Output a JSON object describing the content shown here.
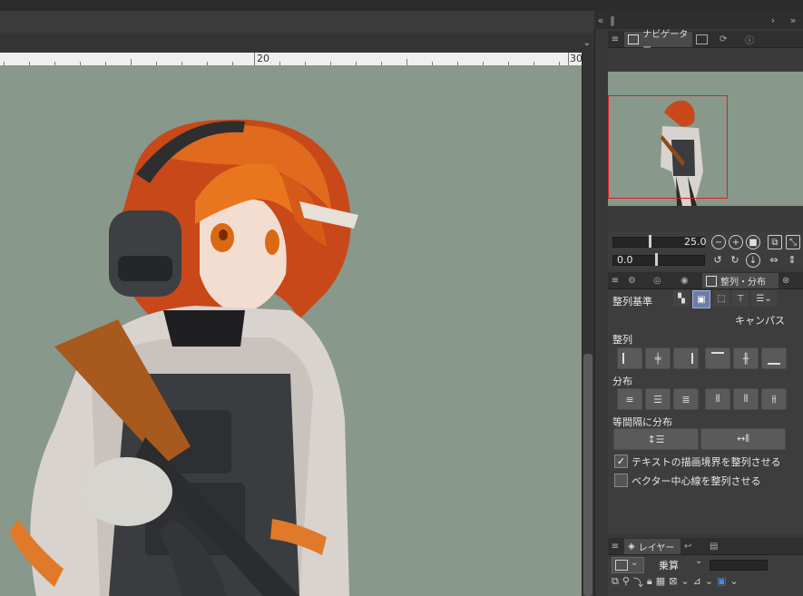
{
  "navigator": {
    "tab_label": "ナビゲーター",
    "zoom": "25.0",
    "rotation": "0.0"
  },
  "ruler": {
    "marks": [
      "20",
      "30"
    ]
  },
  "align_panel": {
    "tab_label": "整列・分布",
    "criteria_label": "整列基準",
    "criteria_value": "キャンパス",
    "align_label": "整列",
    "distribute_label": "分布",
    "equal_label": "等間隔に分布",
    "check1": "テキストの描画境界を整列させる",
    "check2": "ベクター中心線を整列させる",
    "check1_checked": true,
    "check2_checked": false
  },
  "layer_panel": {
    "tab_label": "レイヤー",
    "blend_mode": "乗算"
  },
  "colors": {
    "canvas_bg": "#88988a",
    "navigator_frame": "#e02020",
    "panel_bg": "#3d3d3d"
  }
}
